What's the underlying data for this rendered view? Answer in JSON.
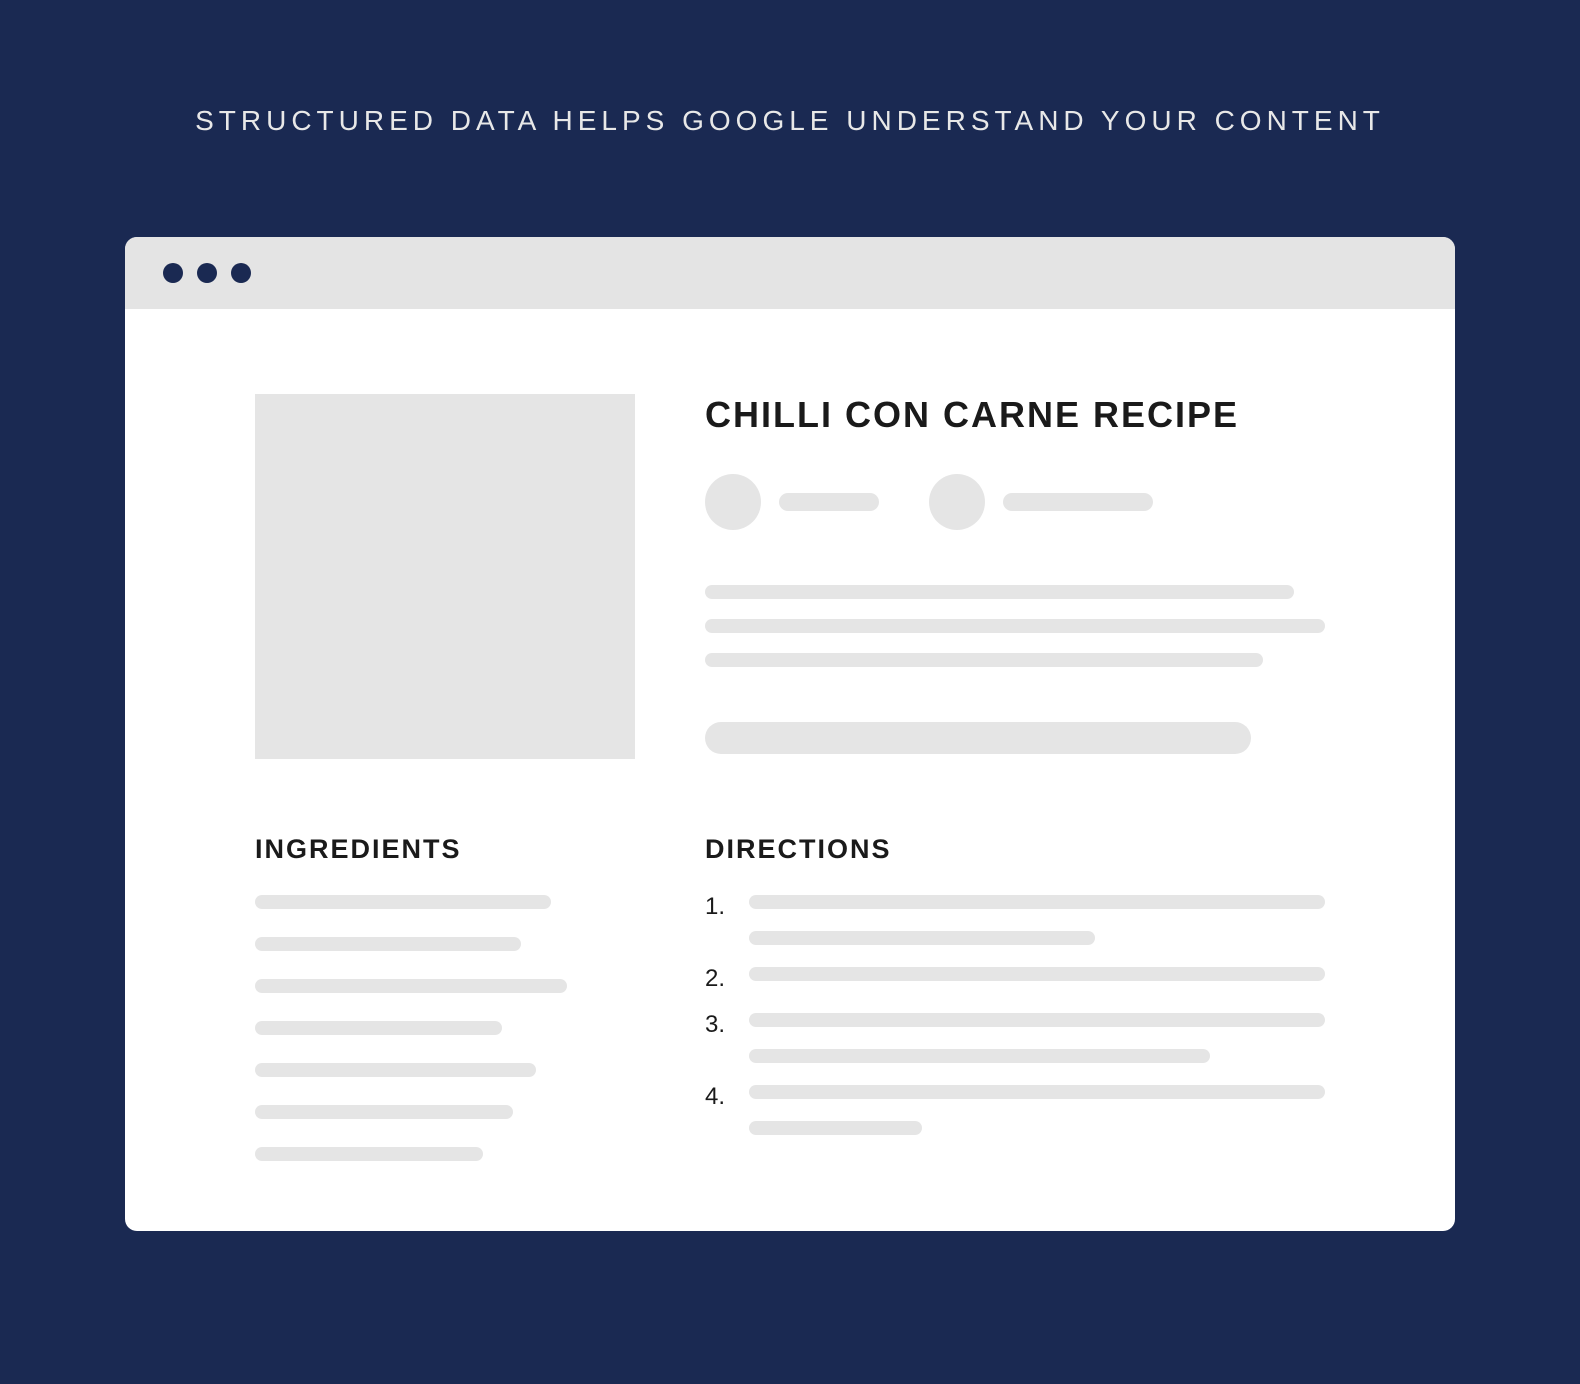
{
  "header": {
    "title": "STRUCTURED DATA HELPS GOOGLE UNDERSTAND YOUR CONTENT"
  },
  "recipe": {
    "title": "CHILLI CON CARNE RECIPE",
    "ingredients_heading": "INGREDIENTS",
    "directions_heading": "DIRECTIONS",
    "directions": [
      {
        "num": "1."
      },
      {
        "num": "2."
      },
      {
        "num": "3."
      },
      {
        "num": "4."
      }
    ]
  },
  "colors": {
    "background": "#1a2952",
    "placeholder": "#e5e5e5",
    "chrome": "#e4e4e4"
  }
}
